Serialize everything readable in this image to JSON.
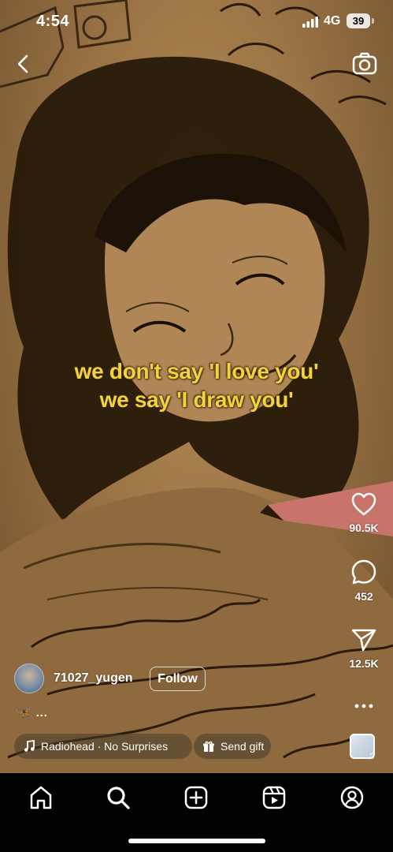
{
  "status_bar": {
    "time": "4:54",
    "network": "4G",
    "battery": "39"
  },
  "caption": {
    "line1": "we don't say 'I love you'",
    "line2": "we say 'I draw you'"
  },
  "actions": {
    "likes": "90.5K",
    "comments": "452",
    "shares": "12.5K"
  },
  "author": {
    "username": "71027_yugen",
    "follow_label": "Follow"
  },
  "description": {
    "emoji": "🦋",
    "more": "..."
  },
  "music": {
    "label": "Radiohead · No Surprises"
  },
  "gift": {
    "label": "Send gift"
  },
  "icons": {
    "back": "chevron-left-icon",
    "camera": "camera-icon",
    "like": "heart-icon",
    "comment": "comment-icon",
    "share": "send-icon",
    "more": "more-icon",
    "music": "music-note-icon",
    "gift": "gift-icon",
    "home": "home-icon",
    "search": "search-icon",
    "create": "plus-square-icon",
    "reels": "reels-icon",
    "profile": "profile-icon"
  },
  "colors": {
    "caption": "#f3d23a",
    "background": "#000000",
    "sepia": "#a87e4c"
  }
}
